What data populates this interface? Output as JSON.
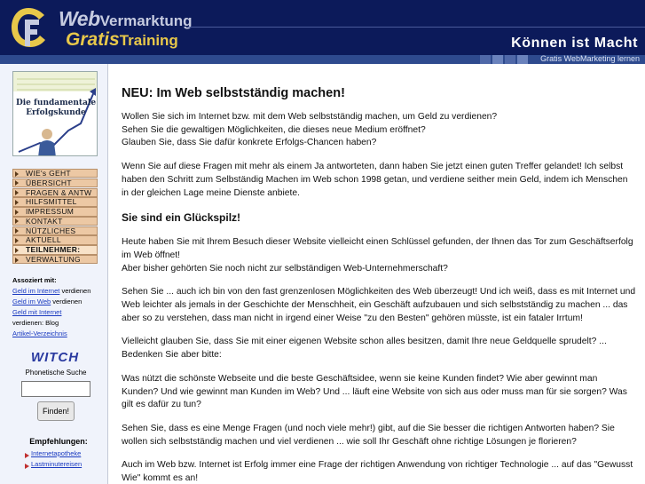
{
  "header": {
    "brand_web": "Web",
    "brand_vermarktung": "Vermarktung",
    "brand_gratis": "Gratis",
    "brand_training": "Training",
    "slogan": "Können ist Macht",
    "subbar_text": "Gratis WebMarketing lernen"
  },
  "sidebar": {
    "banner_title": "Die fundamentale Erfolgskunde",
    "menu": [
      {
        "label": "WIE's GEHT"
      },
      {
        "label": "ÜBERSICHT"
      },
      {
        "label": "FRAGEN & ANTW"
      },
      {
        "label": "HILFSMITTEL"
      },
      {
        "label": "IMPRESSUM"
      },
      {
        "label": "KONTAKT"
      },
      {
        "label": "NÜTZLICHES"
      },
      {
        "label": "AKTUELL"
      },
      {
        "label": "TEILNEHMER:",
        "active": true
      },
      {
        "label": "VERWALTUNG"
      }
    ],
    "associated": {
      "heading": "Assoziert mit:",
      "link1": "Geld im Internet",
      "text1": " verdienen",
      "link2": "Geld im Web",
      "text2": " verdienen",
      "link3": "Geld mit Internet",
      "text3": "verdienen: Blog",
      "link4": "Artikel-Verzeichnis"
    },
    "search": {
      "logo": "WITCH",
      "label": "Phonetische Suche",
      "button": "Finden!",
      "value": ""
    },
    "recommendations": {
      "heading": "Empfehlungen:",
      "items": [
        "Internetapotheke",
        "Lastminutereisen"
      ]
    }
  },
  "content": {
    "title": "NEU: Im Web selbstständig machen!",
    "p1_l1": "Wollen Sie sich im Internet bzw. mit dem Web selbstständig machen, um Geld zu verdienen?",
    "p1_l2": "Sehen Sie die gewaltigen Möglichkeiten, die dieses neue Medium eröffnet?",
    "p1_l3": "Glauben Sie, dass Sie dafür konkrete Erfolgs-Chancen haben?",
    "p2": "Wenn Sie auf diese Fragen mit mehr als einem Ja antworteten, dann haben Sie jetzt einen guten Treffer gelandet! Ich selbst haben den Schritt zum Selbständig Machen im Web schon 1998 getan, und verdiene seither mein Geld, indem ich Menschen in der gleichen Lage meine Dienste anbiete.",
    "subtitle": "Sie sind ein Glückspilz!",
    "p3_l1": "Heute haben Sie mit Ihrem Besuch dieser Website vielleicht einen Schlüssel gefunden, der Ihnen das Tor zum Geschäftserfolg im Web öffnet!",
    "p3_l2": "Aber bisher gehörten Sie noch nicht zur selbständigen Web-Unternehmerschaft?",
    "p4": "Sehen Sie ... auch ich bin von den fast grenzenlosen Möglichkeiten des Web überzeugt! Und ich weiß, dass es mit Internet und Web leichter als jemals in der Geschichte der Menschheit, ein Geschäft aufzubauen und sich selbstständig zu machen ... das aber so zu verstehen, dass man nicht in irgend einer Weise \"zu den Besten\" gehören müsste, ist ein fataler Irrtum!",
    "p5": "Vielleicht glauben Sie, dass Sie mit einer eigenen Website schon alles besitzen, damit Ihre neue Geldquelle sprudelt? ... Bedenken Sie aber bitte:",
    "p6": "Was nützt die schönste Webseite und die beste Geschäftsidee, wenn sie keine Kunden findet? Wie aber gewinnt man Kunden? Und wie gewinnt man Kunden im Web? Und ... läuft eine Website von sich aus oder muss man für sie sorgen? Was gilt es dafür zu tun?",
    "p7": "Sehen Sie, dass es eine Menge Fragen (und noch viele mehr!) gibt, auf die Sie besser die richtigen Antworten haben? Sie wollen sich selbstständig machen und viel verdienen ... wie soll Ihr Geschäft ohne richtige Lösungen je florieren?",
    "p8": "Auch im Web bzw. Internet ist Erfolg immer eine Frage der richtigen Anwendung von richtiger Technologie ... auf das \"Gewusst Wie\" kommt es an!"
  }
}
